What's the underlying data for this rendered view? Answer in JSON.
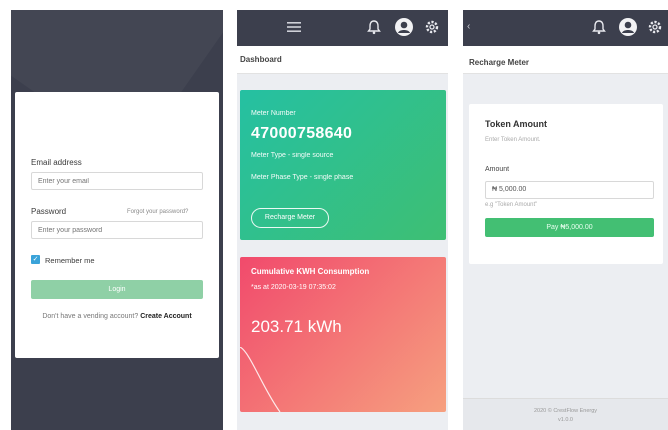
{
  "login": {
    "email_label": "Email address",
    "email_placeholder": "Enter your email",
    "password_label": "Password",
    "forgot_link": "Forgot your password?",
    "password_placeholder": "Enter your password",
    "remember_label": "Remember me",
    "login_button": "Login",
    "signup_prefix": "Don't have a vending account?",
    "signup_link": "Create Account"
  },
  "dashboard": {
    "title": "Dashboard",
    "icons": [
      "menu-icon",
      "bell-icon",
      "user-icon",
      "gear-icon"
    ],
    "meter_card": {
      "heading": "Meter Number",
      "meter_number": "47000758640",
      "meter_type": "Meter Type - single source",
      "meter_phase": "Meter Phase Type - single phase",
      "button": "Recharge Meter",
      "color": "#2bbf95"
    },
    "consumption_card": {
      "title": "Cumulative KWH Consumption",
      "subtitle": "*as at 2020-03-19 07:35:02",
      "value": "203.71 kWh",
      "color": "#f35c70"
    }
  },
  "recharge": {
    "title": "Recharge Meter",
    "icons": [
      "back-icon",
      "bell-icon",
      "user-icon",
      "gear-icon"
    ],
    "card_title": "Token Amount",
    "card_hint": "Enter Token Amount.",
    "amount_label": "Amount",
    "amount_value": "₦ 5,000.00",
    "example": "e.g \"Token Amount\"",
    "pay_button": "Pay ₦5,000.00",
    "footer_line1": "2020 © CrestFlow Energy",
    "footer_line2": "v1.0.0"
  },
  "colors": {
    "topbar": "#3c3f4d",
    "accent_green": "#43bf73",
    "checkbox": "#3aa3d9"
  }
}
